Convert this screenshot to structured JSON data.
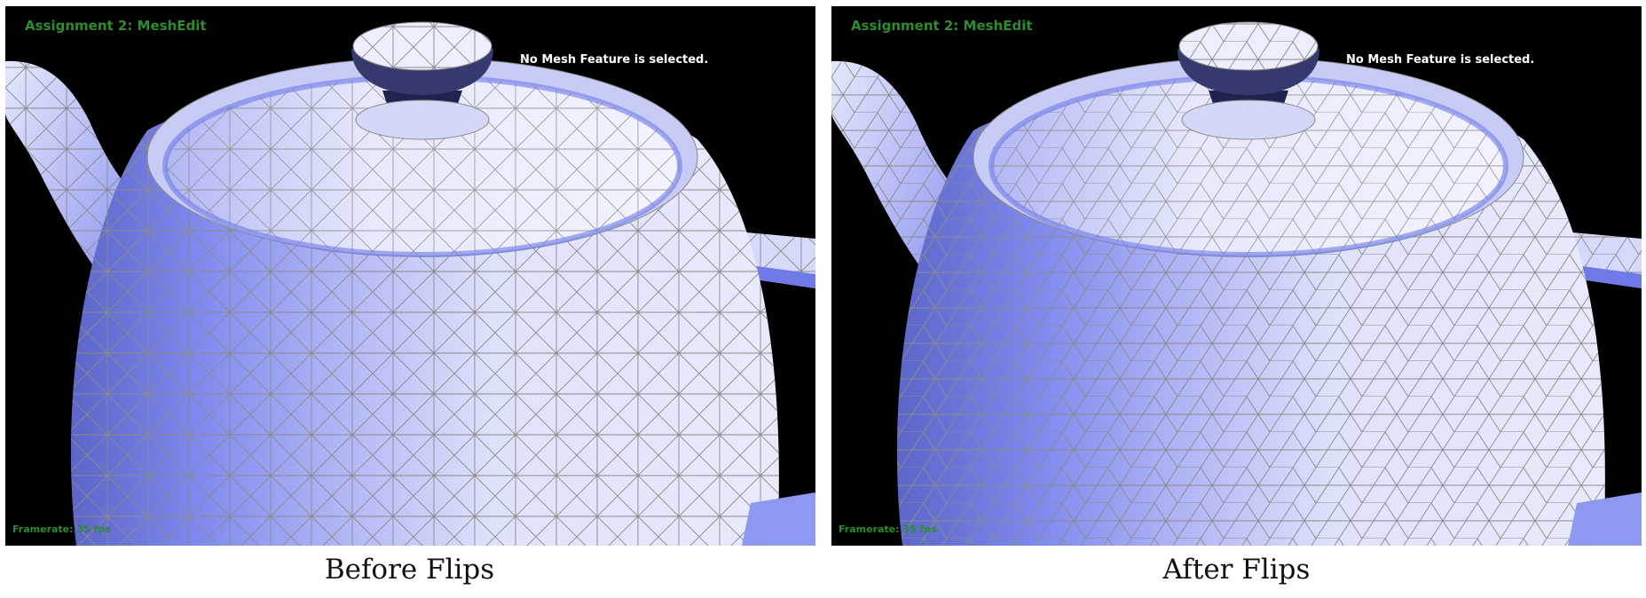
{
  "panels": [
    {
      "app_title": "Assignment 2: MeshEdit",
      "status": "No Mesh Feature is selected.",
      "framerate": "Framerate: 35 fps",
      "caption": "Before Flips"
    },
    {
      "app_title": "Assignment 2: MeshEdit",
      "status": "No Mesh Feature is selected.",
      "framerate": "Framerate: 35 fps",
      "caption": "After Flips"
    }
  ],
  "colors": {
    "background": "#000000",
    "hud_green": "#2e8b2e",
    "mesh_light": "#e6e8fb",
    "mesh_mid": "#b6bcf4",
    "mesh_dark": "#7c86ee",
    "wireframe": "#8a8a8a"
  }
}
